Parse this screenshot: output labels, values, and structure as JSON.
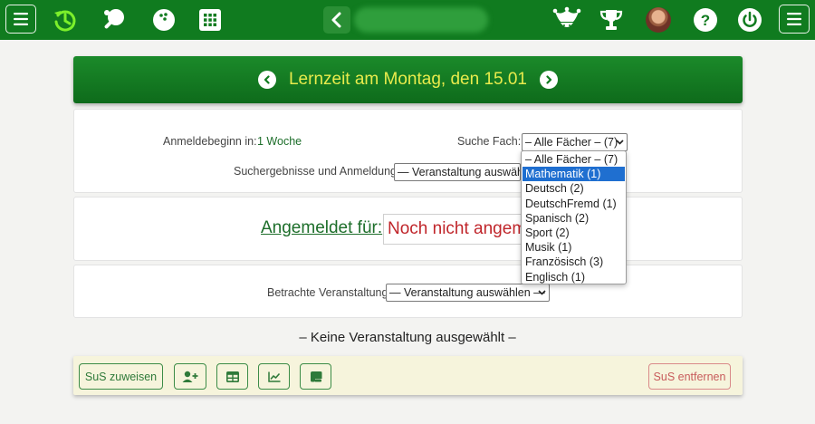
{
  "banner": {
    "title": "Lernzeit am Montag, den 15.01"
  },
  "registration": {
    "start_label": "Anmeldebeginn in:",
    "start_value": "1 Woche",
    "subject_search_label": "Suche Fach:",
    "subject_select_value": "– Alle Fächer – (7)",
    "results_label": "Suchergebnisse und Anmeldung:",
    "results_select_value": "— Veranstaltung auswählen —"
  },
  "enrolled": {
    "label": "Angemeldet für:",
    "value": "Noch nicht angemeldet"
  },
  "view": {
    "label": "Betrachte Veranstaltung:",
    "select_value": "— Veranstaltung auswählen —"
  },
  "subject_options": [
    {
      "label": "– Alle Fächer – (7)",
      "selected": false
    },
    {
      "label": "Mathematik (1)",
      "selected": true
    },
    {
      "label": "Deutsch (2)",
      "selected": false
    },
    {
      "label": "DeutschFremd (1)",
      "selected": false
    },
    {
      "label": "Spanisch (2)",
      "selected": false
    },
    {
      "label": "Sport (2)",
      "selected": false
    },
    {
      "label": "Musik (1)",
      "selected": false
    },
    {
      "label": "Französisch (3)",
      "selected": false
    },
    {
      "label": "Englisch (1)",
      "selected": false
    }
  ],
  "no_event_text": "– Keine Veranstaltung ausgewählt –",
  "footer": {
    "assign_label": "SuS zuweisen",
    "remove_label": "SuS entfernen"
  },
  "topbar_icons": [
    "menu-icon",
    "history-icon",
    "table-tennis-icon",
    "bowling-ball-icon",
    "grid-icon",
    "back-chevron-icon",
    "jester-hat-icon",
    "trophy-icon",
    "avatar",
    "help-icon",
    "power-icon",
    "menu-icon"
  ],
  "colors": {
    "brand_green": "#107b1f",
    "banner_title": "#e8eb4c",
    "enrolled_red": "#c0262b",
    "selected_option": "#1f6fd0",
    "footer_bg": "#f6f4dc"
  }
}
